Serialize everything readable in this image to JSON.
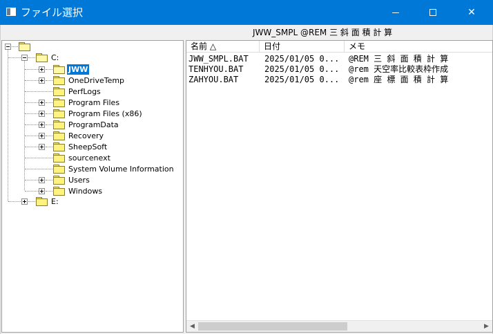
{
  "window": {
    "title": "ファイル選択",
    "icon": "window-app-icon",
    "controls": {
      "minimize": "minimize-icon",
      "maximize": "maximize-icon",
      "close": "✕"
    }
  },
  "path_label": "JWW_SMPL  @REM 三 斜 面 積 計 算",
  "tree": {
    "root_label": "",
    "drive_c": "C:",
    "folders": [
      {
        "label": "JWW",
        "expandable": true,
        "selected": true
      },
      {
        "label": "OneDriveTemp",
        "expandable": true,
        "selected": false
      },
      {
        "label": "PerfLogs",
        "expandable": false,
        "selected": false
      },
      {
        "label": "Program Files",
        "expandable": true,
        "selected": false
      },
      {
        "label": "Program Files (x86)",
        "expandable": true,
        "selected": false
      },
      {
        "label": "ProgramData",
        "expandable": true,
        "selected": false
      },
      {
        "label": "Recovery",
        "expandable": true,
        "selected": false
      },
      {
        "label": "SheepSoft",
        "expandable": true,
        "selected": false
      },
      {
        "label": "sourcenext",
        "expandable": false,
        "selected": false
      },
      {
        "label": "System Volume Information",
        "expandable": false,
        "selected": false
      },
      {
        "label": "Users",
        "expandable": true,
        "selected": false
      },
      {
        "label": "Windows",
        "expandable": true,
        "selected": false
      }
    ],
    "drive_e": "E:"
  },
  "list": {
    "columns": [
      "名前 △",
      "日付",
      "メモ"
    ],
    "rows": [
      {
        "name": "JWW_SMPL.BAT",
        "date": "2025/01/05 0...",
        "memo": "@REM 三 斜 面 積 計 算"
      },
      {
        "name": "TENHYOU.BAT",
        "date": "2025/01/05 0...",
        "memo": "@rem 天空率比較表枠作成"
      },
      {
        "name": "ZAHYOU.BAT",
        "date": "2025/01/05 0...",
        "memo": "@rem 座 標 面 積 計 算"
      }
    ]
  },
  "scrollbar": {
    "left_arrow": "◀",
    "right_arrow": "▶",
    "position": 0.0
  },
  "colors": {
    "titlebar": "#0078d7",
    "selection": "#0078d7",
    "folder": "#fff380"
  }
}
